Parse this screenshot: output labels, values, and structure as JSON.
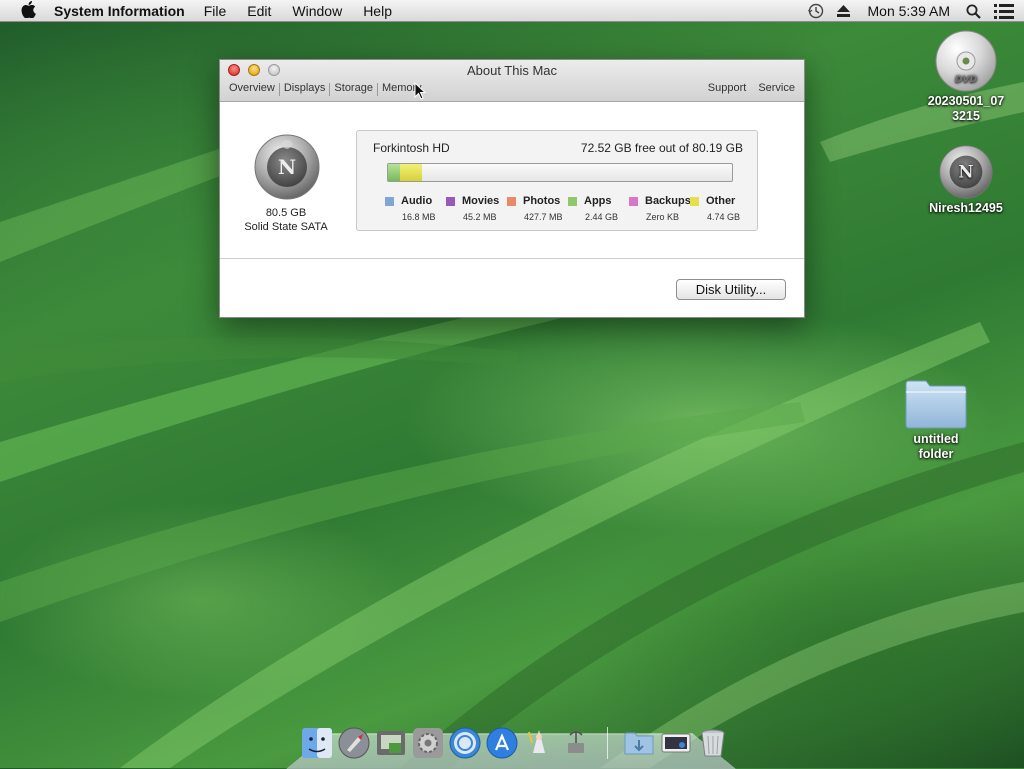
{
  "menubar": {
    "app_name": "System Information",
    "menus": [
      "File",
      "Edit",
      "Window",
      "Help"
    ],
    "clock": "Mon 5:39 AM",
    "icons": [
      "apple-icon",
      "time-machine-icon",
      "eject-icon",
      "spotlight-search-icon",
      "notification-list-icon"
    ]
  },
  "window": {
    "title": "About This Mac",
    "tabs": [
      "Overview",
      "Displays",
      "Storage",
      "Memory"
    ],
    "active_tab": "Storage",
    "right_links": [
      "Support",
      "Service"
    ],
    "disk": {
      "size": "80.5 GB",
      "type": "Solid State SATA",
      "icon_letter": "N"
    },
    "storage": {
      "drive_name": "Forkintosh HD",
      "free_text": "72.52 GB free out of 80.19 GB",
      "legend": [
        {
          "label": "Audio",
          "size": "16.8 MB",
          "color": "#7fa6d6"
        },
        {
          "label": "Movies",
          "size": "45.2 MB",
          "color": "#9b59b6"
        },
        {
          "label": "Photos",
          "size": "427.7 MB",
          "color": "#e8896a"
        },
        {
          "label": "Apps",
          "size": "2.44 GB",
          "color": "#8dc96b"
        },
        {
          "label": "Backups",
          "size": "Zero KB",
          "color": "#d777c8"
        },
        {
          "label": "Other",
          "size": "4.74 GB",
          "color": "#e4e04a"
        }
      ]
    },
    "disk_utility_button": "Disk Utility..."
  },
  "desktop": {
    "items": [
      {
        "label_line1": "20230501_07",
        "label_line2": "3215",
        "icon": "dvd-disc-icon"
      },
      {
        "label_line1": "Niresh12495",
        "label_line2": "",
        "icon": "hard-drive-icon"
      },
      {
        "label_line1": "untitled",
        "label_line2": "folder",
        "icon": "folder-icon"
      }
    ]
  },
  "dock": {
    "apps": [
      "finder-icon",
      "launchpad-icon",
      "image-capture-icon",
      "system-preferences-icon",
      "safari-icon",
      "app-store-icon",
      "wizard-icon",
      "network-utility-icon",
      "downloads-folder-icon",
      "preview-icon",
      "trash-icon"
    ]
  },
  "colors": {
    "window_bg": "#ffffff",
    "menubar_bg": "#e8e8e8",
    "close": "#d6261c",
    "minimize": "#d99a0f"
  }
}
